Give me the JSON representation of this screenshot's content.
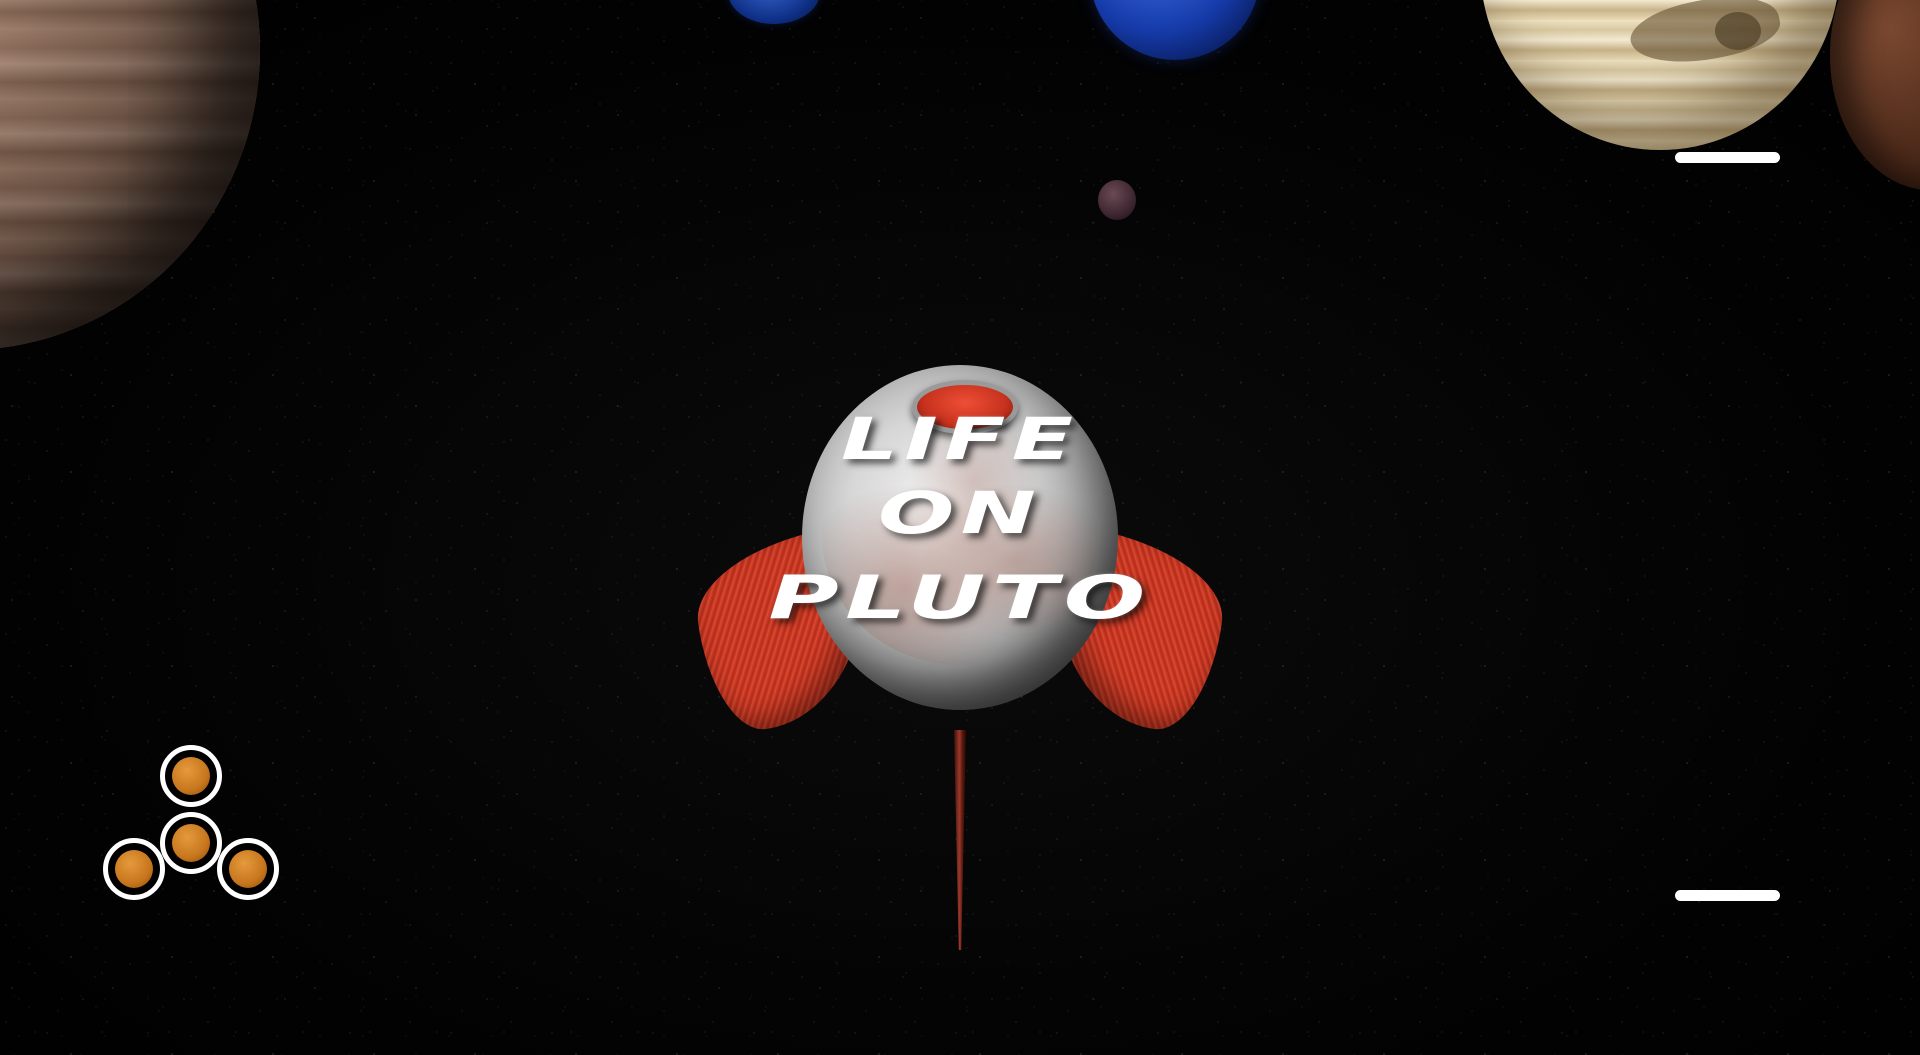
{
  "game": {
    "title_lines": [
      "LIFE",
      "ON",
      "PLUTO"
    ]
  },
  "hud": {
    "top_bar": "menu-bar",
    "bottom_bar": "menu-bar",
    "joystick": {
      "buttons": [
        "up",
        "center",
        "left",
        "right"
      ],
      "color": "#d9832a"
    }
  },
  "scene": {
    "background": "starfield",
    "bodies": [
      "brown-gas-giant",
      "small-blue-planet",
      "large-blue-planet",
      "small-moon",
      "banded-cream-planet",
      "dark-red-planet"
    ],
    "ship": "rocket-ship"
  }
}
